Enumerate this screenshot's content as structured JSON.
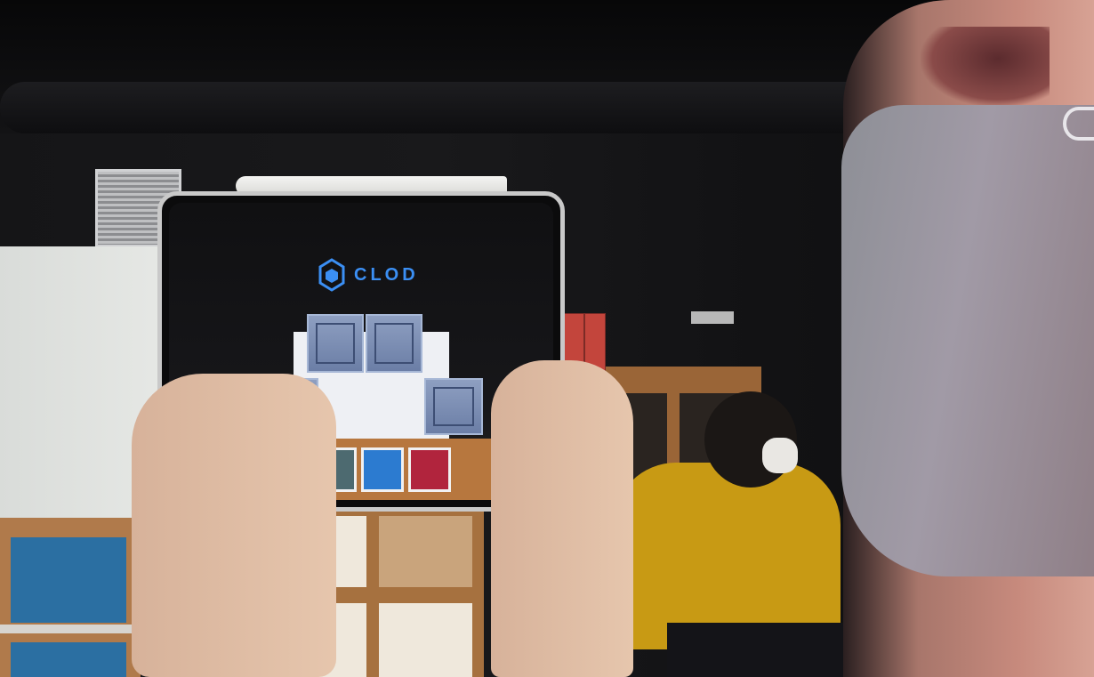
{
  "scene": {
    "description_tag": "photo",
    "ipad_app": {
      "logo_text": "CLOD",
      "logo_icon": "hexagon-cube-icon",
      "accent_color": "#3b8ff4"
    }
  }
}
